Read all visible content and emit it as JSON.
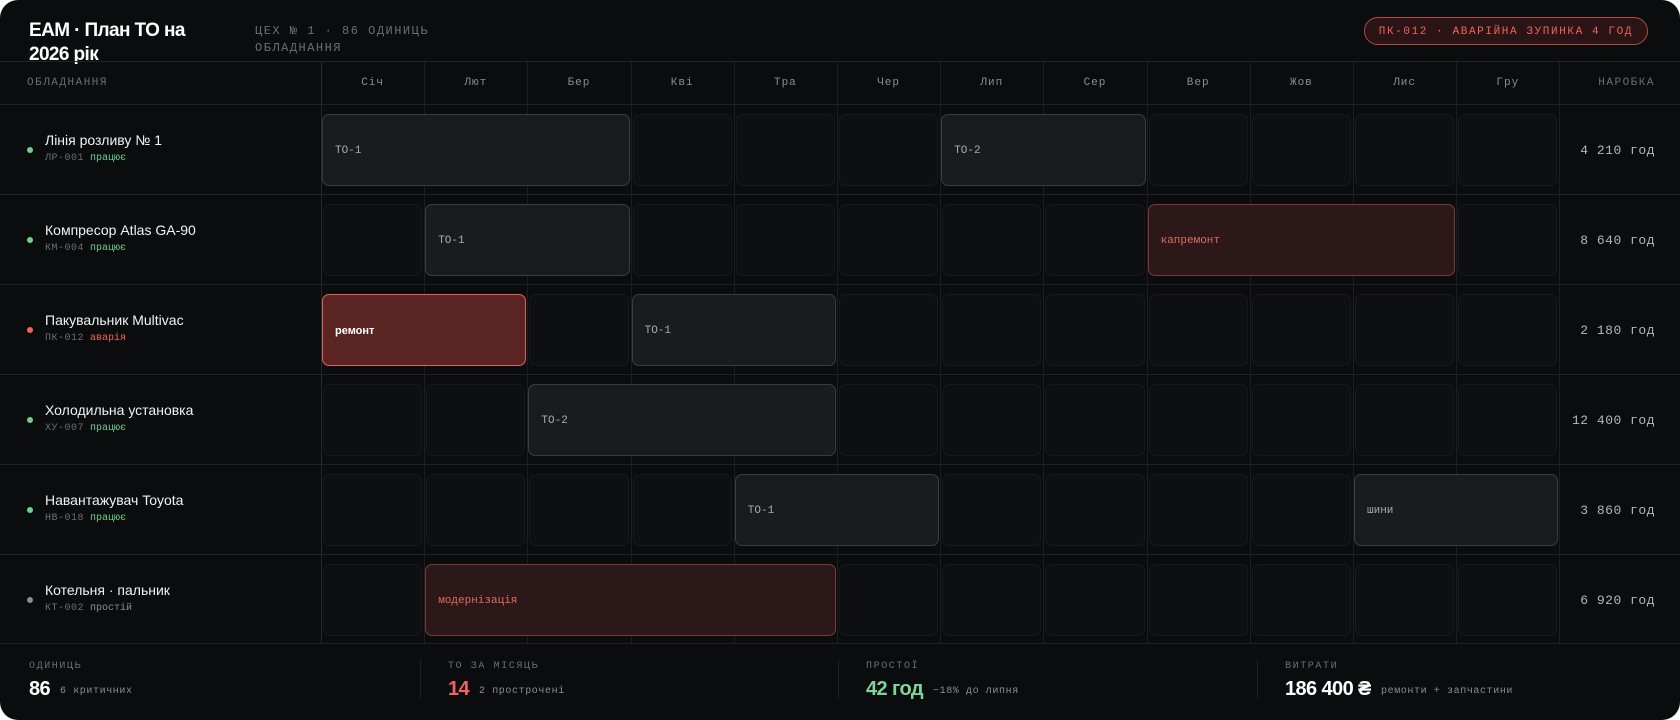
{
  "header": {
    "title": "EAM · План ТО на 2026 рік",
    "subtitle": "ЦЕХ № 1 · 86 ОДИНИЦЬ ОБЛАДНАННЯ",
    "alert": "ПК-012 · АВАРІЙНА ЗУПИНКА 4 ГОД"
  },
  "table": {
    "equipment_header": "ОБЛАДНАННЯ",
    "hours_header": "НАРОБКА",
    "months": [
      "Січ",
      "Лют",
      "Бер",
      "Кві",
      "Тра",
      "Чер",
      "Лип",
      "Сер",
      "Вер",
      "Жов",
      "Лис",
      "Гру"
    ],
    "rows": [
      {
        "name": "Лінія розливу № 1",
        "code": "ЛР-001",
        "status": "працює",
        "status_kind": "ok",
        "hours": "4 210 год",
        "tasks": [
          {
            "label": "ТО-1",
            "start": 1,
            "end": 3,
            "kind": "normal"
          },
          {
            "label": "ТО-2",
            "start": 7,
            "end": 8,
            "kind": "normal"
          }
        ]
      },
      {
        "name": "Компресор Atlas GA-90",
        "code": "КМ-004",
        "status": "працює",
        "status_kind": "ok",
        "hours": "8 640 год",
        "tasks": [
          {
            "label": "ТО-1",
            "start": 2,
            "end": 3,
            "kind": "normal"
          },
          {
            "label": "капремонт",
            "start": 9,
            "end": 11,
            "kind": "warn"
          }
        ]
      },
      {
        "name": "Пакувальник Multivac",
        "code": "ПК-012",
        "status": "аварія",
        "status_kind": "alarm",
        "hours": "2 180 год",
        "tasks": [
          {
            "label": "ремонт",
            "start": 1,
            "end": 2,
            "kind": "critical"
          },
          {
            "label": "ТО-1",
            "start": 4,
            "end": 5,
            "kind": "normal"
          }
        ]
      },
      {
        "name": "Холодильна установка",
        "code": "ХУ-007",
        "status": "працює",
        "status_kind": "ok",
        "hours": "12 400 год",
        "tasks": [
          {
            "label": "ТО-2",
            "start": 3,
            "end": 5,
            "kind": "normal"
          }
        ]
      },
      {
        "name": "Навантажувач Toyota",
        "code": "НВ-018",
        "status": "працює",
        "status_kind": "ok",
        "hours": "3 860 год",
        "tasks": [
          {
            "label": "ТО-1",
            "start": 5,
            "end": 6,
            "kind": "normal"
          },
          {
            "label": "шини",
            "start": 11,
            "end": 12,
            "kind": "normal"
          }
        ]
      },
      {
        "name": "Котельня · пальник",
        "code": "КТ-002",
        "status": "простій",
        "status_kind": "idle",
        "hours": "6 920 год",
        "tasks": [
          {
            "label": "модернізація",
            "start": 2,
            "end": 5,
            "kind": "warn"
          }
        ]
      }
    ]
  },
  "stats": [
    {
      "label": "ОДИНИЦЬ",
      "value": "86",
      "note": "6 критичних",
      "color": "#ffffff"
    },
    {
      "label": "ТО ЗА МІСЯЦЬ",
      "value": "14",
      "note": "2 прострочені",
      "color": "#f0645c"
    },
    {
      "label": "ПРОСТОЇ",
      "value": "42 год",
      "note": "−18% до липня",
      "color": "#7fd49a"
    },
    {
      "label": "ВИТРАТИ",
      "value": "186 400 ₴",
      "note": "ремонти + запчастини",
      "color": "#ffffff"
    }
  ],
  "colors": {
    "ok": "#6fd08c",
    "alarm": "#f0645c",
    "idle": "#8a8d93",
    "accent": "#f0645c"
  }
}
